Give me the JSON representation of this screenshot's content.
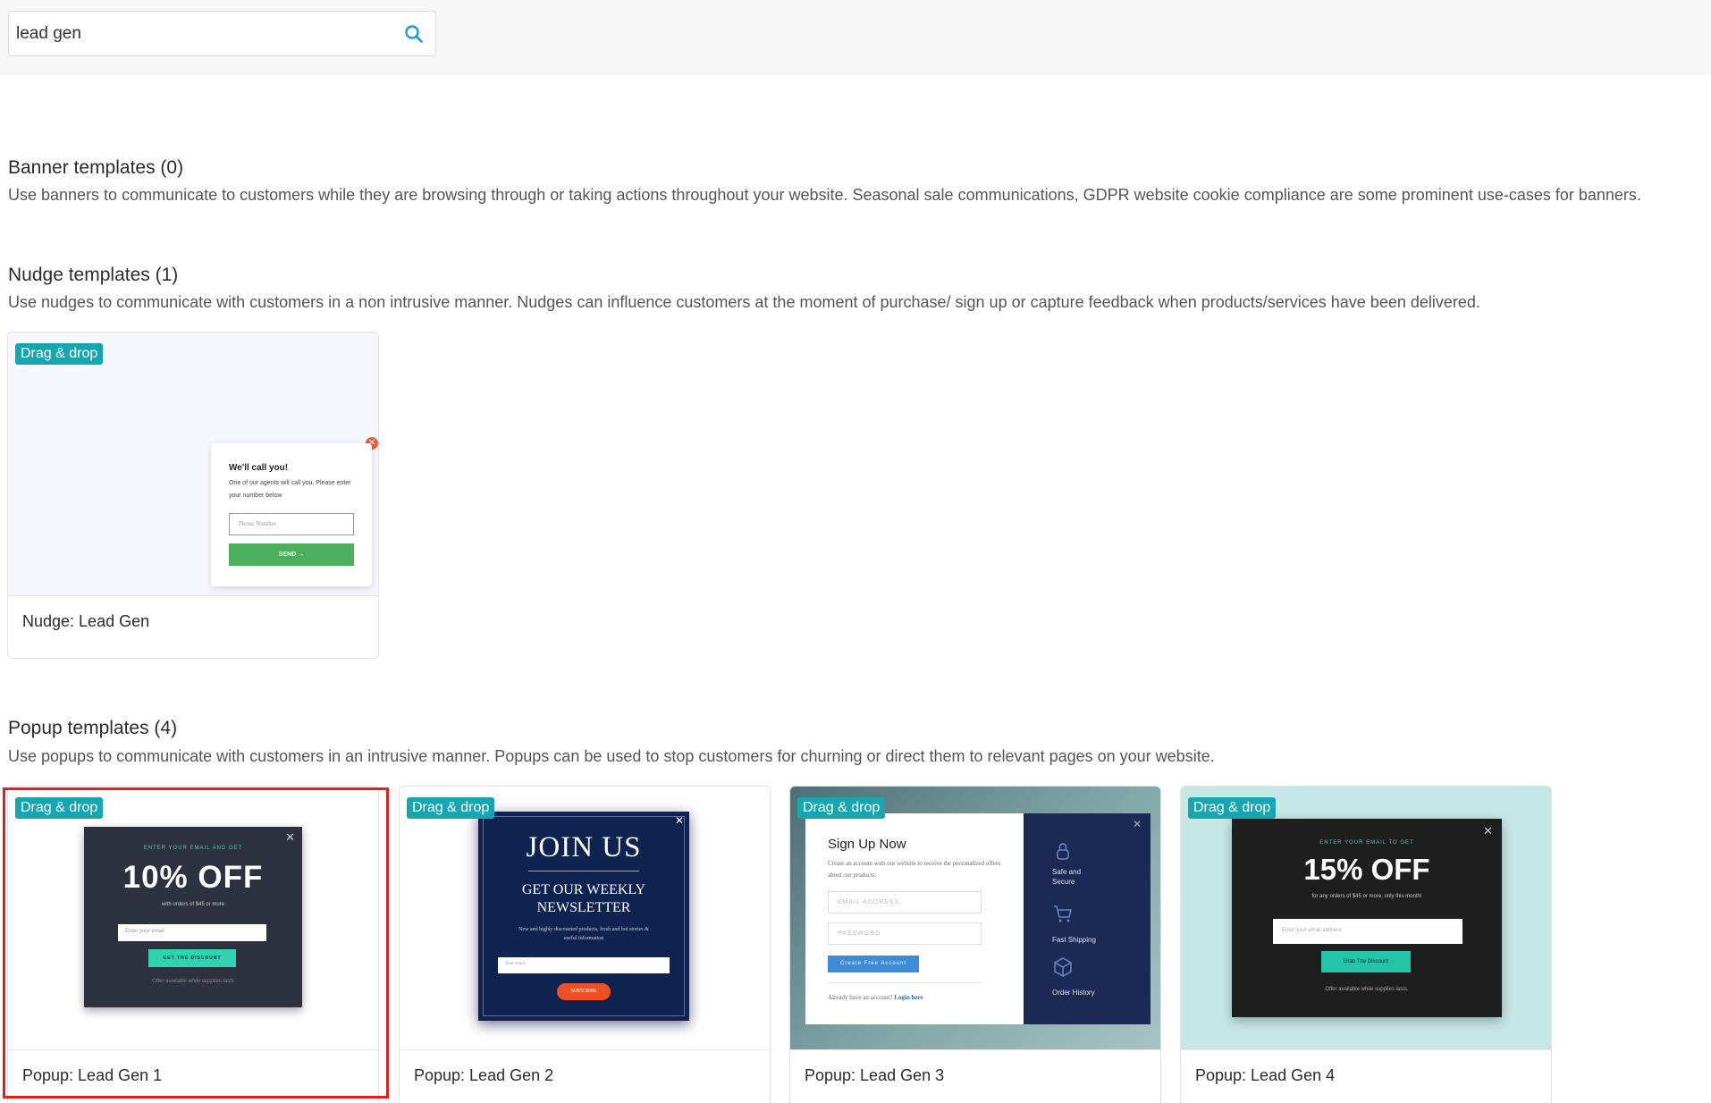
{
  "search": {
    "value": "lead gen"
  },
  "sections": {
    "banner": {
      "title": "Banner templates (0)",
      "description": "Use banners to communicate to customers while they are browsing through or taking actions throughout your website. Seasonal sale communications, GDPR website cookie compliance are some prominent use-cases for banners."
    },
    "nudge": {
      "title": "Nudge templates (1)",
      "description": "Use nudges to communicate with customers in a non intrusive manner. Nudges can influence customers at the moment of purchase/ sign up or capture feedback when products/services have been delivered."
    },
    "popup": {
      "title": "Popup templates (4)",
      "description": "Use popups to communicate with customers in an intrusive manner. Popups can be used to stop customers for churning or direct them to relevant pages on your website."
    }
  },
  "badge_label": "Drag & drop",
  "nudge_cards": [
    {
      "caption": "Nudge: Lead Gen",
      "preview": {
        "title": "We'll call you!",
        "subtitle": "One of our agents will call you. Please enter your number below",
        "placeholder": "Phone Number",
        "button": "SEND →"
      }
    }
  ],
  "popup_cards": [
    {
      "caption": "Popup: Lead Gen 1",
      "selected": true,
      "preview": {
        "kicker": "ENTER YOUR EMAIL AND GET",
        "headline": "10% OFF",
        "subtitle": "with orders of $45 or more",
        "placeholder": "Enter your email",
        "button": "GET THE DISCOUNT",
        "footer": "Offer available while supplies lasts"
      }
    },
    {
      "caption": "Popup: Lead Gen 2",
      "preview": {
        "headline": "JOIN US",
        "subheadline_1": "GET OUR WEEKLY",
        "subheadline_2": "NEWSLETTER",
        "subtitle": "New and highly discounted products, fresh and hot stories & useful information",
        "placeholder": "Your email",
        "button": "SUBSCRIBE"
      }
    },
    {
      "caption": "Popup: Lead Gen 3",
      "preview": {
        "headline": "Sign Up Now",
        "subtitle": "Create an account with our website to receive the personalized offers about our products.",
        "email_placeholder": "EMAIL ADDRESS",
        "password_placeholder": "PASSWORD",
        "button": "Create Free Account",
        "footer_text": "Already have an account?",
        "footer_link": "Login here",
        "features": [
          "Safe and Secure",
          "Fast Shipping",
          "Order History"
        ]
      }
    },
    {
      "caption": "Popup: Lead Gen 4",
      "preview": {
        "kicker": "ENTER YOUR EMAIL TO GET",
        "headline": "15% OFF",
        "subtitle": "for any orders of $45 or more, only this month!",
        "placeholder": "Enter your email address",
        "button": "Grab The Discount",
        "footer": "Offer available while supplies lasts."
      }
    }
  ],
  "colors": {
    "badge": "#17a6b0",
    "selection": "#e02020",
    "accent_green": "#4caf5c",
    "accent_teal": "#2fd3b0"
  }
}
